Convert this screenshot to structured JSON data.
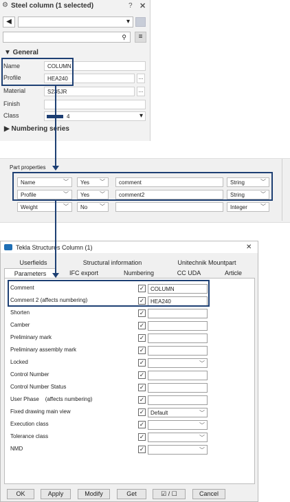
{
  "pane": {
    "title": "Steel column (1 selected)",
    "help_icon": "?",
    "close_icon": "✕",
    "back_icon": "◀",
    "combo_chevron": "▾",
    "search_icon": "⚲",
    "menu_icon": "≡",
    "section_general": "▼ General",
    "section_numbering": "▶ Numbering series",
    "fields": [
      {
        "label": "Name",
        "value": "COLUMN"
      },
      {
        "label": "Profile",
        "value": "HEA240"
      },
      {
        "label": "Material",
        "value": "S235JR"
      },
      {
        "label": "Finish",
        "value": ""
      },
      {
        "label": "Class",
        "value": "4"
      }
    ],
    "dots": "..."
  },
  "parts": {
    "title": "Part properties",
    "rows": [
      {
        "name": "Name",
        "visible": "Yes",
        "attribute": "comment",
        "type": "String"
      },
      {
        "name": "Profile",
        "visible": "Yes",
        "attribute": "comment2",
        "type": "String"
      },
      {
        "name": "Weight",
        "visible": "No",
        "attribute": "",
        "type": "Integer"
      }
    ]
  },
  "dialog": {
    "title": "Tekla Structures  Column (1)",
    "close": "✕",
    "tabs_row1": [
      "Userfields",
      "Structural information",
      "Unitechnik Mountpart"
    ],
    "tabs_row2": [
      "Parameters",
      "IFC export",
      "Numbering",
      "CC UDA",
      "Article"
    ],
    "rows": [
      {
        "label": "Comment",
        "value": "COLUMN",
        "dropdown": false
      },
      {
        "label": "Comment 2 (affects numbering)",
        "value": "HEA240",
        "dropdown": false
      },
      {
        "label": "Shorten",
        "value": "",
        "dropdown": false
      },
      {
        "label": "Camber",
        "value": "",
        "dropdown": false
      },
      {
        "label": "Preliminary mark",
        "value": "",
        "dropdown": false
      },
      {
        "label": "Preliminary assembly mark",
        "value": "",
        "dropdown": false
      },
      {
        "label": "Locked",
        "value": "",
        "dropdown": true
      },
      {
        "label": "Control Number",
        "value": "",
        "dropdown": false
      },
      {
        "label": "Control Number Status",
        "value": "",
        "dropdown": false
      },
      {
        "label": "User Phase    (affects numbering)",
        "value": "",
        "dropdown": false
      },
      {
        "label": "Fixed drawing main view",
        "value": "Default",
        "dropdown": true
      },
      {
        "label": "Execution class",
        "value": "",
        "dropdown": true
      },
      {
        "label": "Tolerance class",
        "value": "",
        "dropdown": true
      },
      {
        "label": "NMD",
        "value": "",
        "dropdown": true
      }
    ],
    "buttons": {
      "ok": "OK",
      "apply": "Apply",
      "modify": "Modify",
      "get": "Get",
      "toggle": "☑ / ☐",
      "cancel": "Cancel"
    }
  },
  "colors": {
    "highlight": "#1d3f73",
    "class_swatch": "#1d3f73"
  }
}
